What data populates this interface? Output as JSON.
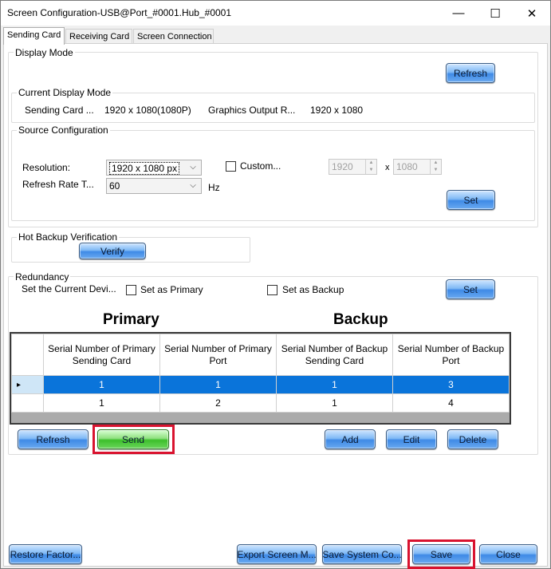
{
  "window": {
    "title": "Screen Configuration-USB@Port_#0001.Hub_#0001",
    "minimize_glyph": "—",
    "maximize_glyph": "☐",
    "close_glyph": "✕"
  },
  "tabs": [
    {
      "label": "Sending Card",
      "active": true
    },
    {
      "label": "Receiving Card",
      "active": false
    },
    {
      "label": "Screen Connection",
      "active": false
    }
  ],
  "display_mode": {
    "group_label": "Display Mode",
    "refresh_label": "Refresh"
  },
  "current_display_mode": {
    "group_label": "Current Display Mode",
    "sending_card_label": "Sending Card ...",
    "sending_card_value": "1920 x 1080(1080P)",
    "graphics_output_label": "Graphics Output R...",
    "graphics_output_value": "1920 x 1080"
  },
  "source_config": {
    "group_label": "Source Configuration",
    "resolution_label": "Resolution:",
    "resolution_value": "1920 x 1080 px",
    "custom_label": "Custom...",
    "custom_width": "1920",
    "x_sep": "x",
    "custom_height": "1080",
    "refresh_rate_label": "Refresh Rate T...",
    "refresh_rate_value": "60",
    "hz_label": "Hz",
    "set_label": "Set"
  },
  "hot_backup": {
    "group_label": "Hot Backup Verification",
    "verify_label": "Verify"
  },
  "redundancy": {
    "group_label": "Redundancy",
    "set_current_label": "Set the Current Devi...",
    "set_primary_label": "Set as Primary",
    "set_backup_label": "Set as Backup",
    "set_label": "Set",
    "primary_heading": "Primary",
    "backup_heading": "Backup",
    "columns": [
      "Serial Number of Primary Sending Card",
      "Serial Number of Primary Port",
      "Serial Number of Backup Sending Card",
      "Serial Number of Backup Port"
    ],
    "rows": [
      {
        "cells": [
          "1",
          "1",
          "1",
          "3"
        ],
        "selected": true,
        "marker": "▸"
      },
      {
        "cells": [
          "1",
          "2",
          "1",
          "4"
        ],
        "selected": false,
        "marker": ""
      }
    ],
    "refresh_label": "Refresh",
    "send_label": "Send",
    "add_label": "Add",
    "edit_label": "Edit",
    "delete_label": "Delete"
  },
  "footer": {
    "restore_label": "Restore Factor...",
    "export_label": "Export Screen M...",
    "save_system_label": "Save System Co...",
    "save_label": "Save",
    "close_label": "Close"
  },
  "colors": {
    "highlight": "#d9132f",
    "selected_row": "#0a74da",
    "button_blue": "#3f8ae6",
    "button_green": "#3cbf2b"
  }
}
